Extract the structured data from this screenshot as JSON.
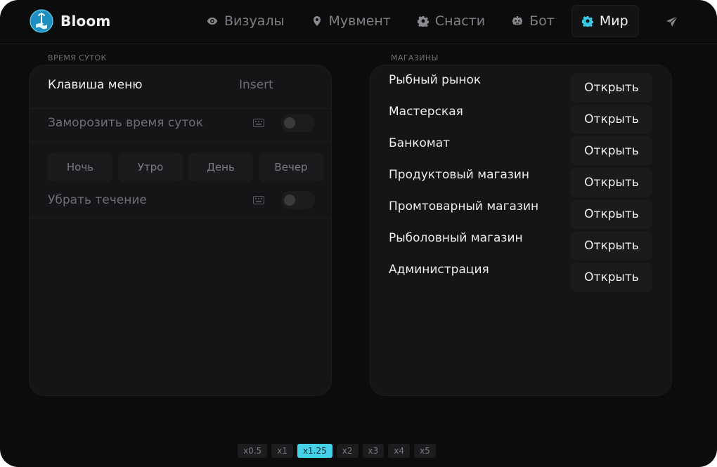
{
  "brand": {
    "name": "Bloom",
    "accent": "#38c8e2"
  },
  "nav": {
    "items": [
      {
        "label": "Визуалы",
        "icon": "eye-icon"
      },
      {
        "label": "Мувмент",
        "icon": "map-pin-icon"
      },
      {
        "label": "Снасти",
        "icon": "gear-icon"
      },
      {
        "label": "Бот",
        "icon": "robot-icon"
      },
      {
        "label": "Мир",
        "icon": "gear-icon",
        "active": true
      }
    ],
    "send_icon": "send-icon"
  },
  "time_section": {
    "title": "ВРЕМЯ СУТОК",
    "menu_key_label": "Клавиша меню",
    "menu_key_value": "Insert",
    "freeze_label": "Заморозить время суток",
    "freeze_enabled": false,
    "times": [
      "Ночь",
      "Утро",
      "День",
      "Вечер"
    ],
    "current_label": "Убрать течение",
    "current_enabled": false
  },
  "shops_section": {
    "title": "МАГАЗИНЫ",
    "open_label": "Открыть",
    "items": [
      "Рыбный рынок",
      "Мастерская",
      "Банкомат",
      "Продуктовый магазин",
      "Промтоварный магазин",
      "Рыболовный магазин",
      "Администрация"
    ]
  },
  "speed": {
    "options": [
      "x0.5",
      "x1",
      "x1.25",
      "x2",
      "x3",
      "x4",
      "x5"
    ],
    "selected": "x1.25",
    "accent": "#45d2e8"
  }
}
